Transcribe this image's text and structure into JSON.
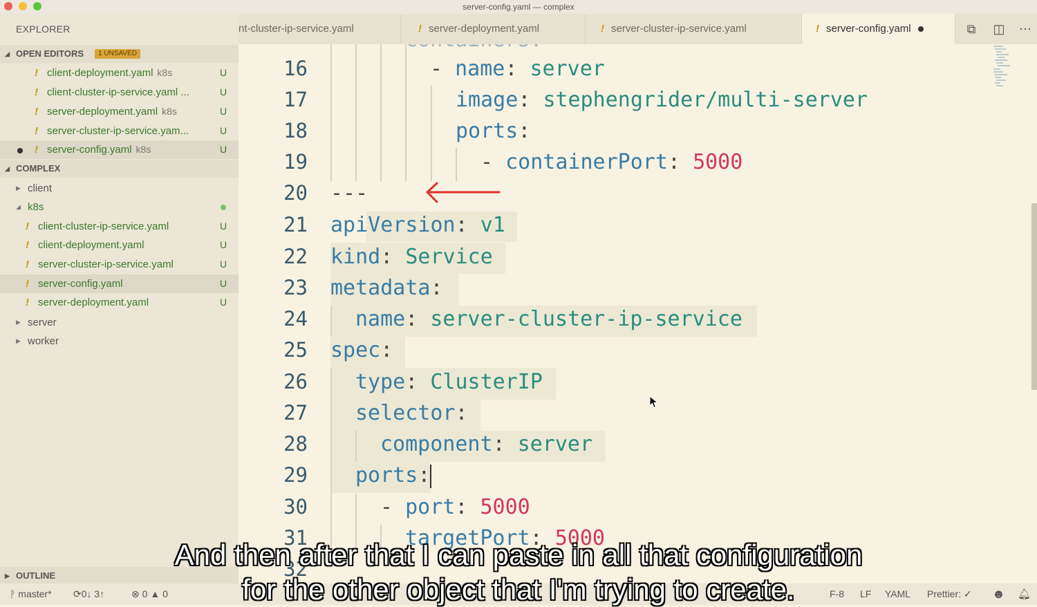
{
  "window": {
    "title": "server-config.yaml — complex"
  },
  "sidebar": {
    "title": "EXPLORER",
    "open_editors": {
      "label": "OPEN EDITORS",
      "badge": "1 UNSAVED",
      "items": [
        {
          "name": "client-deployment.yaml",
          "desc": "k8s",
          "status": "U"
        },
        {
          "name": "client-cluster-ip-service.yaml ...",
          "desc": "",
          "status": "U"
        },
        {
          "name": "server-deployment.yaml",
          "desc": "k8s",
          "status": "U"
        },
        {
          "name": "server-cluster-ip-service.yam...",
          "desc": "",
          "status": "U"
        },
        {
          "name": "server-config.yaml",
          "desc": "k8s",
          "status": "U"
        }
      ]
    },
    "project": {
      "label": "COMPLEX",
      "folders": {
        "client": "client",
        "k8s": "k8s",
        "server": "server",
        "worker": "worker"
      },
      "k8s_files": [
        {
          "name": "client-cluster-ip-service.yaml",
          "status": "U"
        },
        {
          "name": "client-deployment.yaml",
          "status": "U"
        },
        {
          "name": "server-cluster-ip-service.yaml",
          "status": "U"
        },
        {
          "name": "server-config.yaml",
          "status": "U"
        },
        {
          "name": "server-deployment.yaml",
          "status": "U"
        }
      ]
    },
    "outline": "OUTLINE"
  },
  "tabs": [
    {
      "label": "nt-cluster-ip-service.yaml"
    },
    {
      "label": "server-deployment.yaml"
    },
    {
      "label": "server-cluster-ip-service.yaml"
    },
    {
      "label": "server-config.yaml"
    }
  ],
  "editor": {
    "lines": [
      {
        "num": "16"
      },
      {
        "num": "17"
      },
      {
        "num": "18"
      },
      {
        "num": "19"
      },
      {
        "num": "20"
      },
      {
        "num": "21"
      },
      {
        "num": "22"
      },
      {
        "num": "23"
      },
      {
        "num": "24"
      },
      {
        "num": "25"
      },
      {
        "num": "26"
      },
      {
        "num": "27"
      },
      {
        "num": "28"
      },
      {
        "num": "29"
      },
      {
        "num": "30"
      },
      {
        "num": "31"
      },
      {
        "num": "32"
      }
    ],
    "code": {
      "l16": {
        "dash": "- ",
        "key": "name",
        "colon": ": ",
        "val": "server"
      },
      "l17": {
        "key": "image",
        "colon": ": ",
        "val": "stephengrider/multi-server"
      },
      "l18": {
        "key": "ports",
        "colon": ":"
      },
      "l19": {
        "dash": "- ",
        "key": "containerPort",
        "colon": ": ",
        "val": "5000"
      },
      "l20": {
        "sep": "---"
      },
      "l21": {
        "key": "apiVersion",
        "colon": ": ",
        "val": "v1"
      },
      "l22": {
        "key": "kind",
        "colon": ": ",
        "val": "Service"
      },
      "l23": {
        "key": "metadata",
        "colon": ":"
      },
      "l24": {
        "key": "name",
        "colon": ": ",
        "val": "server-cluster-ip-service"
      },
      "l25": {
        "key": "spec",
        "colon": ":"
      },
      "l26": {
        "key": "type",
        "colon": ": ",
        "val": "ClusterIP"
      },
      "l27": {
        "key": "selector",
        "colon": ":"
      },
      "l28": {
        "key": "component",
        "colon": ": ",
        "val": "server"
      },
      "l29": {
        "key": "ports",
        "colon": ":"
      },
      "l30": {
        "dash": "- ",
        "key": "port",
        "colon": ": ",
        "val": "5000"
      },
      "l31": {
        "key": "targetPort",
        "colon": ": ",
        "val": "5000"
      }
    }
  },
  "statusbar": {
    "branch": "master*",
    "sync": "0↓ 3↑",
    "problems": "0",
    "warnings": "0",
    "encoding": "F-8",
    "eol": "LF",
    "language": "YAML",
    "prettier": "Prettier: ✓"
  },
  "caption": {
    "line1": "And then after that I can paste in all that configuration",
    "line2": "for the other object that I'm trying to create."
  },
  "colors": {
    "accent_red": "#e0312b",
    "untracked_green": "#3c7a2a",
    "warning_yellow": "#c59a00"
  }
}
